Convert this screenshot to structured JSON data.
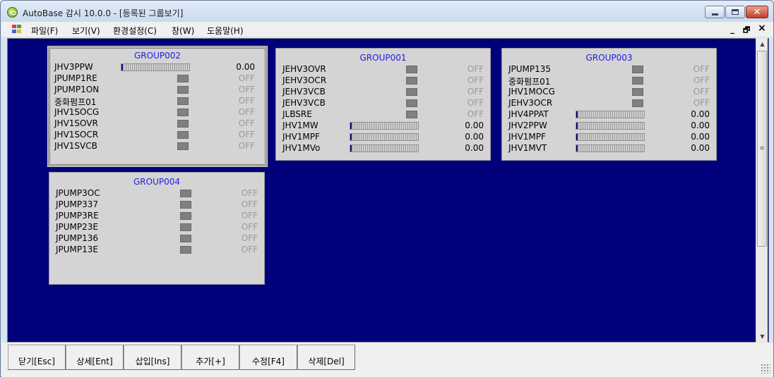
{
  "window": {
    "title": "AutoBase 감시 10.0.0 - [등록된 그룹보기]"
  },
  "menu": {
    "items": [
      "파일(F)",
      "보기(V)",
      "환경설정(C)",
      "창(W)",
      "도움말(H)"
    ],
    "mdi_minimize": "_",
    "mdi_restore": "🗗",
    "mdi_close": "×"
  },
  "groups": [
    {
      "title": "GROUP002",
      "rows": [
        {
          "label": "JHV3PPW",
          "type": "bar",
          "value": "0.00",
          "level": 0
        },
        {
          "label": "JPUMP1RE",
          "type": "lamp",
          "value": "OFF"
        },
        {
          "label": "JPUMP1ON",
          "type": "lamp",
          "value": "OFF"
        },
        {
          "label": "중화펌프01",
          "type": "lamp",
          "value": "OFF"
        },
        {
          "label": "JHV1SOCG",
          "type": "lamp",
          "value": "OFF"
        },
        {
          "label": "JHV1SOVR",
          "type": "lamp",
          "value": "OFF"
        },
        {
          "label": "JHV1SOCR",
          "type": "lamp",
          "value": "OFF"
        },
        {
          "label": "JHV1SVCB",
          "type": "lamp",
          "value": "OFF"
        }
      ]
    },
    {
      "title": "GROUP001",
      "rows": [
        {
          "label": "JEHV3OVR",
          "type": "lamp",
          "value": "OFF"
        },
        {
          "label": "JEHV3OCR",
          "type": "lamp",
          "value": "OFF"
        },
        {
          "label": "JEHV3VCB",
          "type": "lamp",
          "value": "OFF"
        },
        {
          "label": "JEHV3VCB",
          "type": "lamp",
          "value": "OFF"
        },
        {
          "label": "JLBSRE",
          "type": "lamp",
          "value": "OFF"
        },
        {
          "label": "JHV1MW",
          "type": "bar",
          "value": "0.00",
          "level": 0
        },
        {
          "label": "JHV1MPF",
          "type": "bar",
          "value": "0.00",
          "level": 0
        },
        {
          "label": "JHV1MVo",
          "type": "bar",
          "value": "0.00",
          "level": 0
        }
      ]
    },
    {
      "title": "GROUP003",
      "rows": [
        {
          "label": "JPUMP135",
          "type": "lamp",
          "value": "OFF"
        },
        {
          "label": "중화펌프01",
          "type": "lamp",
          "value": "OFF"
        },
        {
          "label": "JHV1MOCG",
          "type": "lamp",
          "value": "OFF"
        },
        {
          "label": "JEHV3OCR",
          "type": "lamp",
          "value": "OFF"
        },
        {
          "label": "JHV4PPAT",
          "type": "bar",
          "value": "0.00",
          "level": 0
        },
        {
          "label": "JHV2PPW",
          "type": "bar",
          "value": "0.00",
          "level": 0
        },
        {
          "label": "JHV1MPF",
          "type": "bar",
          "value": "0.00",
          "level": 0
        },
        {
          "label": "JHV1MVT",
          "type": "bar",
          "value": "0.00",
          "level": 0
        }
      ]
    },
    {
      "title": "GROUP004",
      "rows": [
        {
          "label": "JPUMP3OC",
          "type": "lamp",
          "value": "OFF"
        },
        {
          "label": "JPUMP337",
          "type": "lamp",
          "value": "OFF"
        },
        {
          "label": "JPUMP3RE",
          "type": "lamp",
          "value": "OFF"
        },
        {
          "label": "JPUMP23E",
          "type": "lamp",
          "value": "OFF"
        },
        {
          "label": "JPUMP136",
          "type": "lamp",
          "value": "OFF"
        },
        {
          "label": "JPUMP13E",
          "type": "lamp",
          "value": "OFF"
        }
      ]
    }
  ],
  "function_buttons": [
    "닫기[Esc]",
    "상세[Ent]",
    "삽입[Ins]",
    "추가[+]",
    "수정[F4]",
    "삭제[Del]"
  ],
  "colors": {
    "client_background": "#00007a",
    "panel_background": "#d4d4d4",
    "group_title": "#2020e0",
    "lamp_off": "#808080",
    "value_off": "#9a9a9a"
  }
}
